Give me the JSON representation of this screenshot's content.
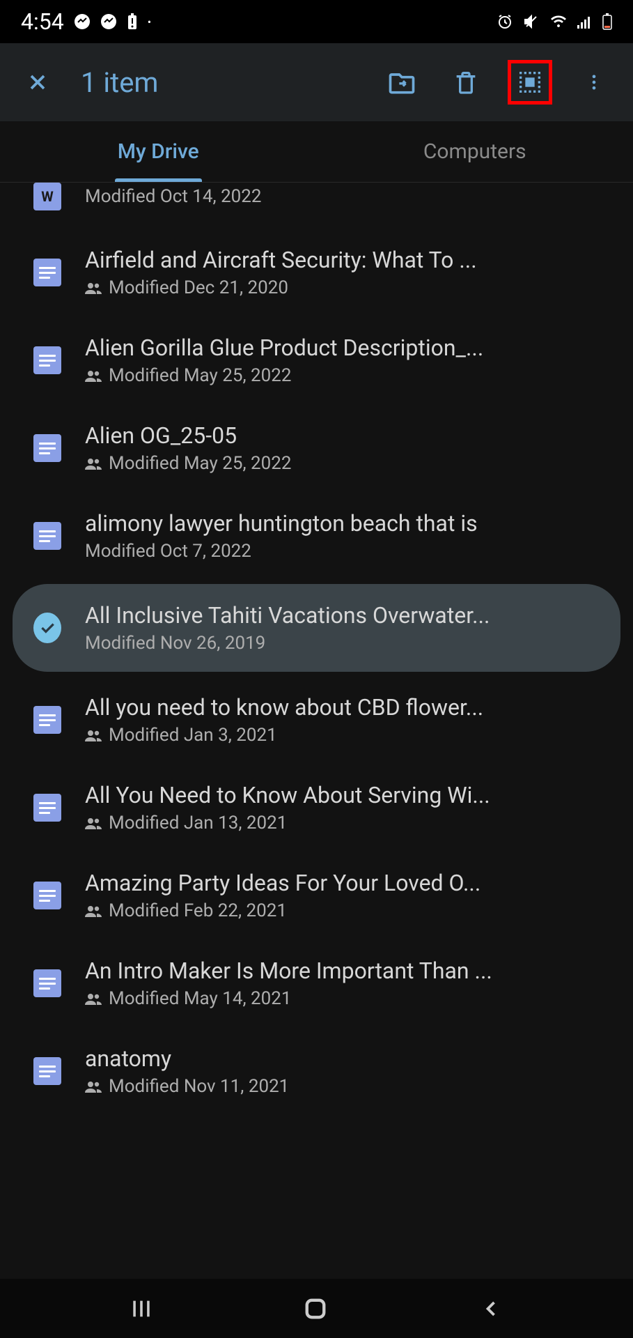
{
  "status": {
    "time": "4:54"
  },
  "header": {
    "title": "1 item"
  },
  "tabs": [
    {
      "label": "My Drive",
      "active": true
    },
    {
      "label": "Computers",
      "active": false
    }
  ],
  "files": [
    {
      "title": "",
      "meta": "Modified Oct 14, 2022",
      "shared": false,
      "icon": "word",
      "partial": true,
      "selected": false
    },
    {
      "title": "Airfield and Aircraft Security: What To ...",
      "meta": "Modified Dec 21, 2020",
      "shared": true,
      "icon": "doc",
      "selected": false
    },
    {
      "title": "Alien Gorilla Glue Product Description_...",
      "meta": "Modified May 25, 2022",
      "shared": true,
      "icon": "doc",
      "selected": false
    },
    {
      "title": "Alien OG_25-05",
      "meta": "Modified May 25, 2022",
      "shared": true,
      "icon": "doc",
      "selected": false
    },
    {
      "title": "alimony lawyer huntington beach that is",
      "meta": "Modified Oct 7, 2022",
      "shared": false,
      "icon": "doc",
      "selected": false
    },
    {
      "title": "All Inclusive Tahiti Vacations Overwater...",
      "meta": "Modified Nov 26, 2019",
      "shared": false,
      "icon": "check",
      "selected": true
    },
    {
      "title": "All you need to know about CBD flower...",
      "meta": "Modified Jan 3, 2021",
      "shared": true,
      "icon": "doc",
      "selected": false
    },
    {
      "title": "All You Need to Know About Serving Wi...",
      "meta": "Modified Jan 13, 2021",
      "shared": true,
      "icon": "doc",
      "selected": false
    },
    {
      "title": "Amazing Party Ideas For Your Loved O...",
      "meta": "Modified Feb 22, 2021",
      "shared": true,
      "icon": "doc",
      "selected": false
    },
    {
      "title": "An Intro Maker Is More Important Than ...",
      "meta": "Modified May 14, 2021",
      "shared": true,
      "icon": "doc",
      "selected": false
    },
    {
      "title": "anatomy",
      "meta": "Modified Nov 11, 2021",
      "shared": true,
      "icon": "doc",
      "selected": false
    }
  ]
}
